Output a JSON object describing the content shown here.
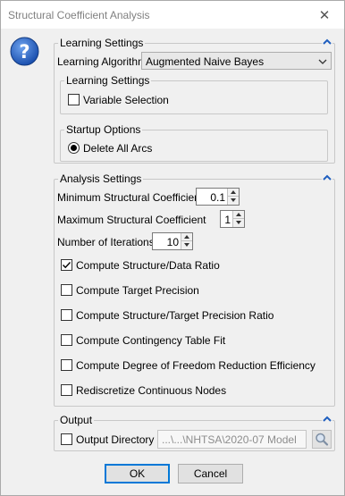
{
  "window": {
    "title": "Structural Coefficient Analysis",
    "close_glyph": "✕"
  },
  "icons": {
    "help": "question-mark-icon",
    "collapse": "chevron-up-icon",
    "dropdown": "chevron-down-icon",
    "browse": "magnifier-icon"
  },
  "colors": {
    "help_blue": "#1f5fbf",
    "default_button_border": "#0078d7",
    "window_bg": "#f0f0f0"
  },
  "learning_settings": {
    "legend": "Learning Settings",
    "algorithm_label": "Learning Algorithm",
    "algorithm_value": "Augmented Naive Bayes",
    "inner_group": {
      "legend": "Learning Settings",
      "variable_selection": {
        "label": "Variable Selection",
        "checked": false
      }
    },
    "startup": {
      "legend": "Startup Options",
      "delete_all_arcs": {
        "label": "Delete All Arcs",
        "selected": true
      }
    }
  },
  "analysis_settings": {
    "legend": "Analysis Settings",
    "min_coef": {
      "label": "Minimum Structural Coefficient",
      "value": "0.1"
    },
    "max_coef": {
      "label": "Maximum Structural Coefficient",
      "value": "1"
    },
    "iterations": {
      "label": "Number of Iterations",
      "value": "10"
    },
    "options": [
      {
        "label": "Compute Structure/Data Ratio",
        "checked": true
      },
      {
        "label": "Compute Target Precision",
        "checked": false
      },
      {
        "label": "Compute Structure/Target Precision Ratio",
        "checked": false
      },
      {
        "label": "Compute Contingency Table Fit",
        "checked": false
      },
      {
        "label": "Compute Degree of Freedom Reduction Efficiency",
        "checked": false
      },
      {
        "label": "Rediscretize Continuous Nodes",
        "checked": false
      }
    ]
  },
  "output": {
    "legend": "Output",
    "directory_label": "Output Directory",
    "directory_checked": false,
    "directory_value": "...\\...\\NHTSA\\2020-07 Model"
  },
  "buttons": {
    "ok": "OK",
    "cancel": "Cancel"
  }
}
